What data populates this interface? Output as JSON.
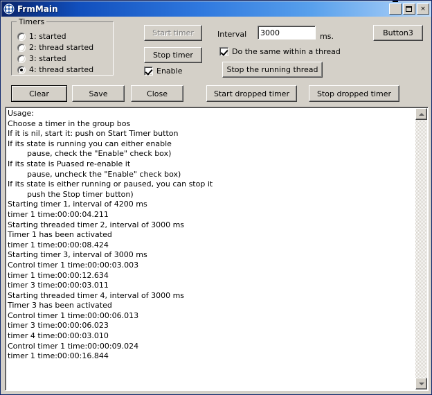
{
  "window": {
    "title": "FrmMain",
    "icon": "app-icon",
    "controls": {
      "minimize": "minimize-icon",
      "maximize": "maximize-icon",
      "close": "×"
    }
  },
  "colors": {
    "title_start": "#0a246a",
    "title_end": "#c3ddf8",
    "face": "#d4d0c8",
    "text": "#000000",
    "disabled_text": "#808080",
    "field_bg": "#ffffff"
  },
  "timers_group": {
    "legend": "Timers",
    "options": [
      {
        "label": "1: started",
        "selected": false
      },
      {
        "label": "2: thread started",
        "selected": false
      },
      {
        "label": "3: started",
        "selected": false
      },
      {
        "label": "4: thread started",
        "selected": true
      }
    ]
  },
  "controls": {
    "start_timer": {
      "label": "Start timer",
      "disabled": true
    },
    "stop_timer": {
      "label": "Stop timer",
      "disabled": false
    },
    "enable_checkbox": {
      "label": "Enable",
      "checked": true
    },
    "interval_label": "Interval",
    "interval_value": "3000",
    "interval_placeholder": "",
    "interval_units": "ms.",
    "thread_checkbox": {
      "label": "Do the same within a thread",
      "checked": true
    },
    "stop_running_thread": {
      "label": "Stop the running thread"
    },
    "button3": {
      "label": "Button3"
    }
  },
  "actions": {
    "clear": "Clear",
    "save": "Save",
    "close": "Close",
    "start_dropped": "Start dropped timer",
    "stop_dropped": "Stop dropped timer"
  },
  "log": {
    "lines": [
      "Usage:",
      "Choose a timer in the group bos",
      "If it is nil, start it: push on Start Timer button",
      "If its state is running you can either enable",
      "        pause, check the \"Enable\" check box)",
      "If its state is Puased re-enable it",
      "        pause, uncheck the \"Enable\" check box)",
      "If its state is either running or paused, you can stop it",
      "        push the Stop timer button)",
      "Starting timer 1, interval of 4200 ms",
      "timer 1 time:00:00:04.211",
      "Starting threaded timer 2, interval of 3000 ms",
      "Timer 1 has been activated",
      "timer 1 time:00:00:08.424",
      "Starting timer 3, interval of 3000 ms",
      "Control timer 1 time:00:00:03.003",
      "timer 1 time:00:00:12.634",
      "timer 3 time:00:00:03.011",
      "Starting threaded timer 4, interval of 3000 ms",
      "Timer 3 has been activated",
      "Control timer 1 time:00:00:06.013",
      "timer 3 time:00:00:06.023",
      "timer 4 time:00:00:03.010",
      "Control timer 1 time:00:00:09.024",
      "timer 1 time:00:00:16.844"
    ]
  },
  "scrollbar": {
    "up_arrow": "scroll-up-icon",
    "down_arrow": "scroll-down-icon"
  }
}
